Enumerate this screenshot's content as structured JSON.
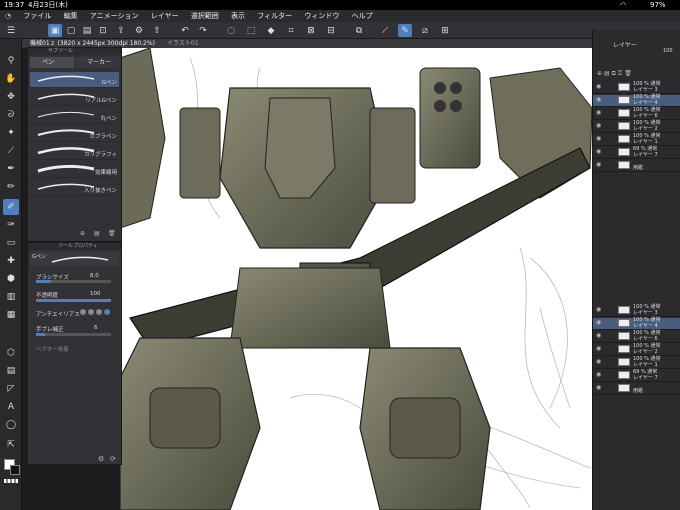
{
  "status": {
    "time": "19:37",
    "date": "4月23日(木)",
    "battery": "97%"
  },
  "menu": [
    "ファイル",
    "編集",
    "アニメーション",
    "レイヤー",
    "選択範囲",
    "表示",
    "フィルター",
    "ウィンドウ",
    "ヘルプ"
  ],
  "document": {
    "title": "機械01ｚ (3820 x 2445px 300dpi 180.2%)",
    "secondary_tab": "イラスト01"
  },
  "subtool_panel": {
    "title": "サブツール",
    "tabs": [
      "ペン",
      "マーカー"
    ],
    "items": [
      {
        "label": "Gペン",
        "selected": true
      },
      {
        "label": "リアルGペン",
        "selected": false
      },
      {
        "label": "丸ペン",
        "selected": false
      },
      {
        "label": "カブラペン",
        "selected": false
      },
      {
        "label": "カリグラフィ",
        "selected": false
      },
      {
        "label": "効果線用",
        "selected": false
      },
      {
        "label": "入り抜きペン",
        "selected": false
      }
    ]
  },
  "tool_property": {
    "title": "ツールプロパティ",
    "name": "Gペン",
    "brush_size_label": "ブラシサイズ",
    "brush_size_value": "8.0",
    "opacity_label": "不透明度",
    "opacity_value": "100",
    "antialias_label": "アンチエイリアス",
    "stabilization_label": "手ブレ補正",
    "stabilization_value": "6",
    "vector_label": "ベクター吸着"
  },
  "layer_panel": {
    "title": "レイヤー",
    "opacity": "100",
    "layers_top": [
      {
        "line1": "100 % 通常",
        "line2": "レイヤー 3",
        "selected": false
      },
      {
        "line1": "100 % 通常",
        "line2": "レイヤー 4",
        "selected": true
      },
      {
        "line1": "100 % 通常",
        "line2": "レイヤー 6",
        "selected": false
      },
      {
        "line1": "100 % 通常",
        "line2": "レイヤー 2",
        "selected": false
      },
      {
        "line1": "100 % 通常",
        "line2": "レイヤー 1",
        "selected": false
      },
      {
        "line1": "69 % 通常",
        "line2": "レイヤー 7",
        "selected": false
      },
      {
        "line1": "",
        "line2": "用紙",
        "selected": false
      }
    ],
    "layers_bottom": [
      {
        "line1": "100 % 通常",
        "line2": "レイヤー 3",
        "selected": false
      },
      {
        "line1": "100 % 通常",
        "line2": "レイヤー 4",
        "selected": true
      },
      {
        "line1": "100 % 通常",
        "line2": "レイヤー 6",
        "selected": false
      },
      {
        "line1": "100 % 通常",
        "line2": "レイヤー 2",
        "selected": false
      },
      {
        "line1": "100 % 通常",
        "line2": "レイヤー 1",
        "selected": false
      },
      {
        "line1": "69 % 通常",
        "line2": "レイヤー 7",
        "selected": false
      },
      {
        "line1": "",
        "line2": "用紙",
        "selected": false
      }
    ]
  },
  "colors": {
    "accent": "#4e80c0",
    "panel": "#323236",
    "selected_row": "#4a5d7e"
  }
}
